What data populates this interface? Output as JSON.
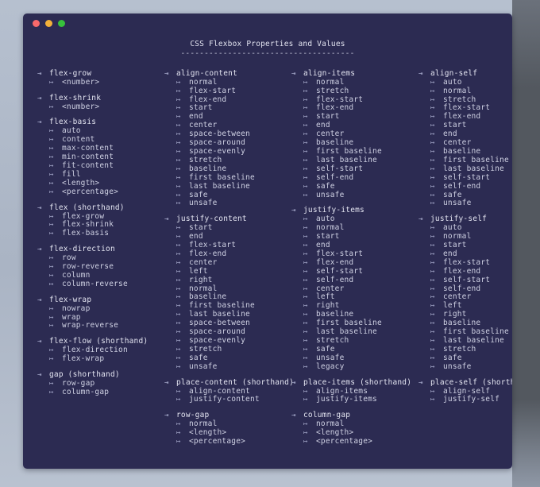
{
  "window": {
    "buttons": [
      {
        "name": "close",
        "color": "#f8696b"
      },
      {
        "name": "minimize",
        "color": "#f2b13a"
      },
      {
        "name": "maximize",
        "color": "#37c13c"
      }
    ],
    "background_color": "#2c2b52",
    "text_color": "#d8d9e8"
  },
  "header": {
    "title": "CSS Flexbox Properties and Values",
    "rule": "-------------------------------------"
  },
  "markers": {
    "property": "⇥",
    "value": "↦"
  },
  "columns": [
    {
      "id": "column-1",
      "groups": [
        {
          "property": "flex-grow",
          "values": [
            "<number>"
          ]
        },
        {
          "property": "flex-shrink",
          "values": [
            "<number>"
          ]
        },
        {
          "property": "flex-basis",
          "values": [
            "auto",
            "content",
            "max-content",
            "min-content",
            "fit-content",
            "fill",
            "<length>",
            "<percentage>"
          ]
        },
        {
          "property": "flex (shorthand)",
          "values": [
            "flex-grow",
            "flex-shrink",
            "flex-basis"
          ]
        },
        {
          "property": "flex-direction",
          "values": [
            "row",
            "row-reverse",
            "column",
            "column-reverse"
          ]
        },
        {
          "property": "flex-wrap",
          "values": [
            "nowrap",
            "wrap",
            "wrap-reverse"
          ]
        },
        {
          "property": "flex-flow (shorthand)",
          "values": [
            "flex-direction",
            "flex-wrap"
          ]
        },
        {
          "property": "gap (shorthand)",
          "values": [
            "row-gap",
            "column-gap"
          ]
        }
      ]
    },
    {
      "id": "column-2",
      "groups": [
        {
          "property": "align-content",
          "values": [
            "normal",
            "flex-start",
            "flex-end",
            "start",
            "end",
            "center",
            "space-between",
            "space-around",
            "space-evenly",
            "stretch",
            "baseline",
            "first baseline",
            "last baseline",
            "safe",
            "unsafe"
          ]
        },
        {
          "property": "justify-content",
          "values": [
            "start",
            "end",
            "flex-start",
            "flex-end",
            "center",
            "left",
            "right",
            "normal",
            "baseline",
            "first baseline",
            "last baseline",
            "space-between",
            "space-around",
            "space-evenly",
            "stretch",
            "safe",
            "unsafe"
          ]
        },
        {
          "property": "place-content (shorthand)",
          "values": [
            "align-content",
            "justify-content"
          ]
        },
        {
          "property": "row-gap",
          "values": [
            "normal",
            "<length>",
            "<percentage>"
          ]
        }
      ]
    },
    {
      "id": "column-3",
      "groups": [
        {
          "property": "align-items",
          "values": [
            "normal",
            "stretch",
            "flex-start",
            "flex-end",
            "start",
            "end",
            "center",
            "baseline",
            "first baseline",
            "last baseline",
            "self-start",
            "self-end",
            "safe",
            "unsafe"
          ]
        },
        {
          "property": "justify-items",
          "values": [
            "auto",
            "normal",
            "start",
            "end",
            "flex-start",
            "flex-end",
            "self-start",
            "self-end",
            "center",
            "left",
            "right",
            "baseline",
            "first baseline",
            "last baseline",
            "stretch",
            "safe",
            "unsafe",
            "legacy"
          ]
        },
        {
          "property": "place-items (shorthand)",
          "values": [
            "align-items",
            "justify-items"
          ]
        },
        {
          "property": "column-gap",
          "values": [
            "normal",
            "<length>",
            "<percentage>"
          ]
        }
      ]
    },
    {
      "id": "column-4",
      "groups": [
        {
          "property": "align-self",
          "values": [
            "auto",
            "normal",
            "stretch",
            "flex-start",
            "flex-end",
            "start",
            "end",
            "center",
            "baseline",
            "first baseline",
            "last baseline",
            "self-start",
            "self-end",
            "safe",
            "unsafe"
          ]
        },
        {
          "property": "justify-self",
          "values": [
            "auto",
            "normal",
            "start",
            "end",
            "flex-start",
            "flex-end",
            "self-start",
            "self-end",
            "center",
            "left",
            "right",
            "baseline",
            "first baseline",
            "last baseline",
            "stretch",
            "safe",
            "unsafe"
          ]
        },
        {
          "property": "place-self (shorthand)",
          "values": [
            "align-self",
            "justify-self"
          ]
        }
      ]
    }
  ]
}
